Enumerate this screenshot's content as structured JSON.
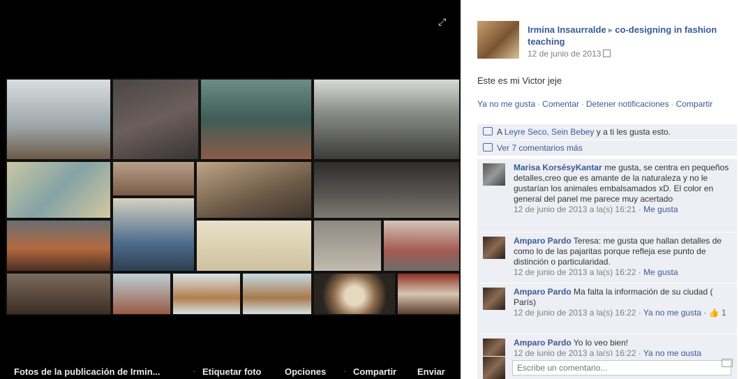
{
  "photo_bar": {
    "caption": "Fotos de la publicación de Irmin...",
    "tag": "Etiquetar foto",
    "options": "Opciones",
    "share": "Compartir",
    "send": "Enviar"
  },
  "post": {
    "author": "Irmina Insaurralde",
    "group": "co-designing in fashion teaching",
    "date": "12 de junio de 2013",
    "text": "Este es mi Victor jeje",
    "actions": [
      "Ya no me gusta",
      "Comentar",
      "Detener notificaciones",
      "Compartir"
    ],
    "likes": {
      "prefix": "A",
      "names": "Leyre Seco, Sein Bebey",
      "suffix": " y a ti les gusta esto."
    },
    "view_more": "Ver 7 comentarios más"
  },
  "comments": [
    {
      "name": "Marisa KorsésyKantar",
      "text": " me gusta, se centra en pequeños detalles,creo que es amante de la naturaleza y no le gustarían los animales embalsamados xD. El color en general del panel me parece muy acertado",
      "meta": "12 de junio de 2013 a la(s) 16:21 · ",
      "action": "Me gusta",
      "likes": ""
    },
    {
      "name": "Amparo Pardo",
      "text": " Teresa: me gusta que hallan detalles de como lo de las pajaritas porque refleja ese punto de distinción o particularidad.",
      "meta": "12 de junio de 2013 a la(s) 16:22 · ",
      "action": "Me gusta",
      "likes": ""
    },
    {
      "name": "Amparo Pardo",
      "text": " Ma falta la información de su ciudad ( París)",
      "meta": "12 de junio de 2013 a la(s) 16:22 · ",
      "action": "Ya no me gusta",
      "likes": " · 👍 1"
    },
    {
      "name": "Amparo Pardo",
      "text": " Yo lo veo bien!",
      "meta": "12 de junio de 2013 a la(s) 16:22 · ",
      "action": "Ya no me gusta",
      "likes": ""
    }
  ],
  "composer": {
    "placeholder": "Escribe un comentario..."
  }
}
